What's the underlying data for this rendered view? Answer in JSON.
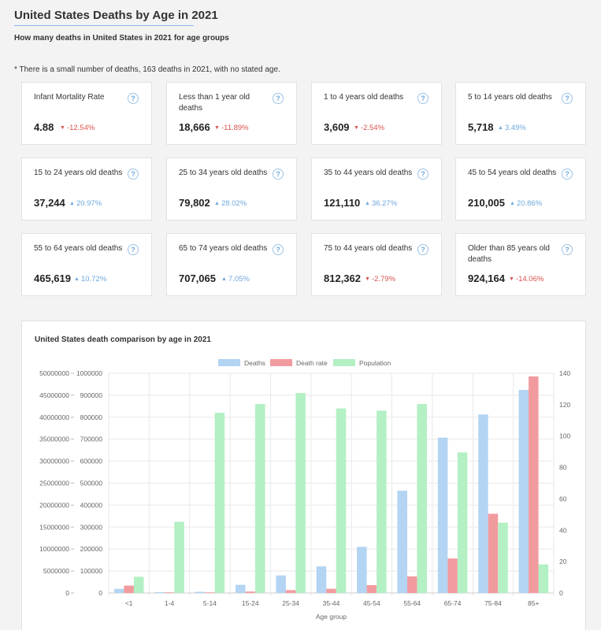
{
  "header": {
    "title": "United States Deaths by Age in 2021",
    "subtitle": "How many deaths in United States in 2021 for age groups",
    "note": "* There is a small number of deaths, 163 deaths in 2021, with no stated age."
  },
  "cards": [
    {
      "label": "Infant Mortality Rate",
      "value": "4.88",
      "change": "-12.54%",
      "direction": "down"
    },
    {
      "label": "Less than 1 year old deaths",
      "value": "18,666",
      "change": "-11.89%",
      "direction": "down"
    },
    {
      "label": "1 to 4 years old deaths",
      "value": "3,609",
      "change": "-2.54%",
      "direction": "down"
    },
    {
      "label": "5 to 14 years old deaths",
      "value": "5,718",
      "change": "3.49%",
      "direction": "up"
    },
    {
      "label": "15 to 24 years old deaths",
      "value": "37,244",
      "change": "20.97%",
      "direction": "up"
    },
    {
      "label": "25 to 34 years old deaths",
      "value": "79,802",
      "change": "28.02%",
      "direction": "up"
    },
    {
      "label": "35 to 44 years old deaths",
      "value": "121,110",
      "change": "36.27%",
      "direction": "up"
    },
    {
      "label": "45 to 54 years old deaths",
      "value": "210,005",
      "change": "20.86%",
      "direction": "up"
    },
    {
      "label": "55 to 64 years old deaths",
      "value": "465,619",
      "change": "10.72%",
      "direction": "up"
    },
    {
      "label": "65 to 74 years old deaths",
      "value": "707,065",
      "change": "7.05%",
      "direction": "up"
    },
    {
      "label": "75 to 44 years old deaths",
      "value": "812,362",
      "change": "-2.79%",
      "direction": "down"
    },
    {
      "label": "Older than 85 years old deaths",
      "value": "924,164",
      "change": "-14.06%",
      "direction": "down"
    }
  ],
  "help_symbol": "?",
  "chart_data": {
    "type": "bar",
    "title": "United States death comparison by age in 2021",
    "xlabel": "Age group",
    "categories": [
      "<1",
      "1-4",
      "5-14",
      "15-24",
      "25-34",
      "35-44",
      "45-54",
      "55-64",
      "65-74",
      "75-84",
      "85+"
    ],
    "series": [
      {
        "name": "Deaths",
        "axis": "y_deaths",
        "color": "#b3d4f2",
        "values": [
          18666,
          3609,
          5718,
          37244,
          79802,
          121110,
          210005,
          465619,
          707065,
          812362,
          924164
        ]
      },
      {
        "name": "Death rate",
        "axis": "y_rate",
        "color": "#f29b9f",
        "values": [
          4.7,
          0.3,
          0.2,
          0.9,
          1.8,
          2.7,
          5,
          10.6,
          22,
          50.5,
          138
        ]
      },
      {
        "name": "Population",
        "axis": "y_population",
        "color": "#b3f0c4",
        "values": [
          3700000,
          16200000,
          41000000,
          43000000,
          45500000,
          42000000,
          41500000,
          43000000,
          32000000,
          16000000,
          6500000
        ]
      }
    ],
    "axes": {
      "y_population": {
        "min": 0,
        "max": 50000000,
        "ticks": [
          "0",
          "5000000",
          "10000000",
          "15000000",
          "20000000",
          "25000000",
          "30000000",
          "35000000",
          "40000000",
          "45000000",
          "50000000"
        ]
      },
      "y_deaths": {
        "min": 0,
        "max": 1000000,
        "ticks": [
          "0",
          "100000",
          "200000",
          "300000",
          "400000",
          "500000",
          "600000",
          "700000",
          "800000",
          "900000",
          "1000000"
        ]
      },
      "y_rate": {
        "min": 0,
        "max": 140,
        "ticks": [
          "0",
          "20",
          "40",
          "60",
          "80",
          "100",
          "120",
          "140"
        ]
      }
    },
    "legend_position": "top",
    "grid": true
  }
}
